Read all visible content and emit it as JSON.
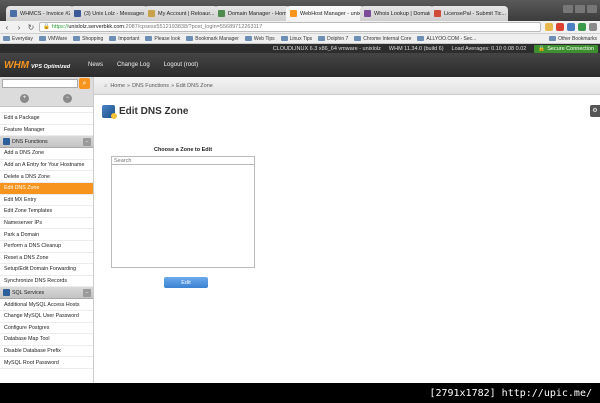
{
  "browser": {
    "tabs": [
      {
        "title": "WHMCS - Invoice #205",
        "fav": "#4a6fa5",
        "active": false
      },
      {
        "title": "(3) Unix Lolz - Messages",
        "fav": "#3b5998",
        "active": false
      },
      {
        "title": "My Account | Reloaur...",
        "fav": "#c8a14b",
        "active": false
      },
      {
        "title": "Domain Manager - Hom...",
        "fav": "#4f8a4f",
        "active": false
      },
      {
        "title": "WebHost Manager - unix",
        "fav": "#f7941d",
        "active": true
      },
      {
        "title": "Whois Lookup | Domain",
        "fav": "#7b4b9a",
        "active": false
      },
      {
        "title": "LicensePal - Submit Tic...",
        "fav": "#d04a3a",
        "active": false
      }
    ],
    "url": {
      "scheme": "https://",
      "host": "unixlolz.serverbkk.com",
      "path": ":2087/cpsess5512193838/?post_login=55689712263117"
    },
    "bookmarks": [
      "Everyday",
      "VMWare",
      "Shopping",
      "Important",
      "Please look",
      "Bookmark Manager",
      "Web Tips",
      "Linux Tips",
      "Dolphin 7",
      "Chrome Internal Core",
      "ALLYOO.COM - Sec..."
    ],
    "bookmarks_right": "Other Bookmarks"
  },
  "whm": {
    "status": {
      "os": "CLOUDLINUX 6.3 x86_64 vmware - unixlolz",
      "version": "WHM 11.34.0 (build 6)",
      "load": "Load Averages: 0.10 0.08 0.02",
      "secure": "Secure Connection"
    },
    "logo": {
      "main": "WHM",
      "sub": "VPS Optimized"
    },
    "nav": [
      "News",
      "Change Log",
      "Logout (root)"
    ]
  },
  "sidebar": {
    "cut_item": "",
    "group1": [
      "Edit a Package",
      "Feature Manager"
    ],
    "dns_header": "DNS Functions",
    "dns_items": [
      "Add a DNS Zone",
      "Add an A Entry for Your Hostname",
      "Delete a DNS Zone",
      "Edit DNS Zone",
      "Edit MX Entry",
      "Edit Zone Templates",
      "Nameserver IPs",
      "Park a Domain",
      "Perform a DNS Cleanup",
      "Reset a DNS Zone",
      "Setup/Edit Domain Forwarding",
      "Synchronize DNS Records"
    ],
    "active_item": "Edit DNS Zone",
    "sql_header": "SQL Services",
    "sql_items": [
      "Additional MySQL Access Hosts",
      "Change MySQL User Password",
      "Configure Postgres",
      "Database Map Tool",
      "Disable Database Prefix",
      "MySQL Root Password"
    ]
  },
  "main": {
    "breadcrumb": {
      "home": "Home",
      "sep": "»",
      "section": "DNS Functions",
      "current": "Edit DNS Zone"
    },
    "title": "Edit DNS Zone",
    "zone_label": "Choose a Zone to Edit",
    "search_placeholder": "Search",
    "edit_button": "Edit"
  },
  "watermark": "[2791x1782] http://upic.me/",
  "colors": {
    "accent": "#f7941d",
    "secure": "#3d8f2f",
    "button": "#3c82d3"
  }
}
